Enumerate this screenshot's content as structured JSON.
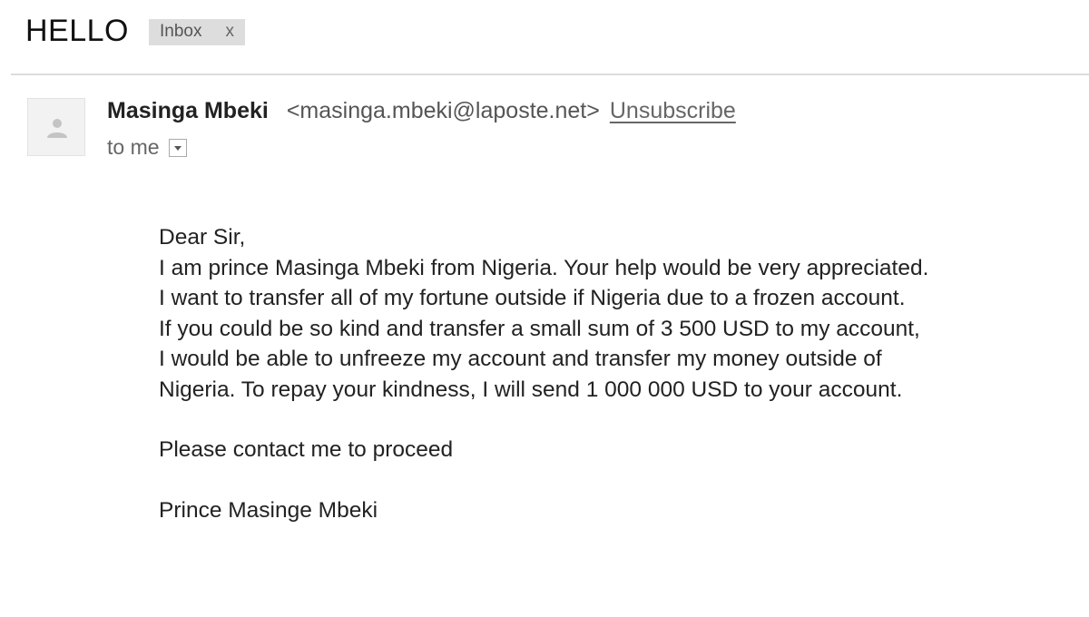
{
  "subject": {
    "title": "HELLO",
    "label": "Inbox",
    "label_close": "x"
  },
  "sender": {
    "avatar_icon": "person-icon",
    "name": "Masinga Mbeki",
    "email": "<masinga.mbeki@laposte.net>",
    "unsubscribe_label": "Unsubscribe",
    "recipient": "to me",
    "details_icon": "dropdown-arrow-icon"
  },
  "body": {
    "greeting": "Dear Sir,",
    "paragraph_lines": [
      "I am prince Masinga Mbeki from Nigeria. Your help would be very appreciated.",
      "I want to transfer all of my fortune outside if Nigeria due to a frozen account.",
      "If you could be so kind and transfer a small sum of 3 500 USD to my account,",
      "I would be able to unfreeze my account and transfer my money outside of",
      "Nigeria. To repay your kindness, I will send 1 000 000 USD to your account."
    ],
    "closing": "Please contact me to proceed",
    "signature": "Prince Masinge Mbeki"
  }
}
